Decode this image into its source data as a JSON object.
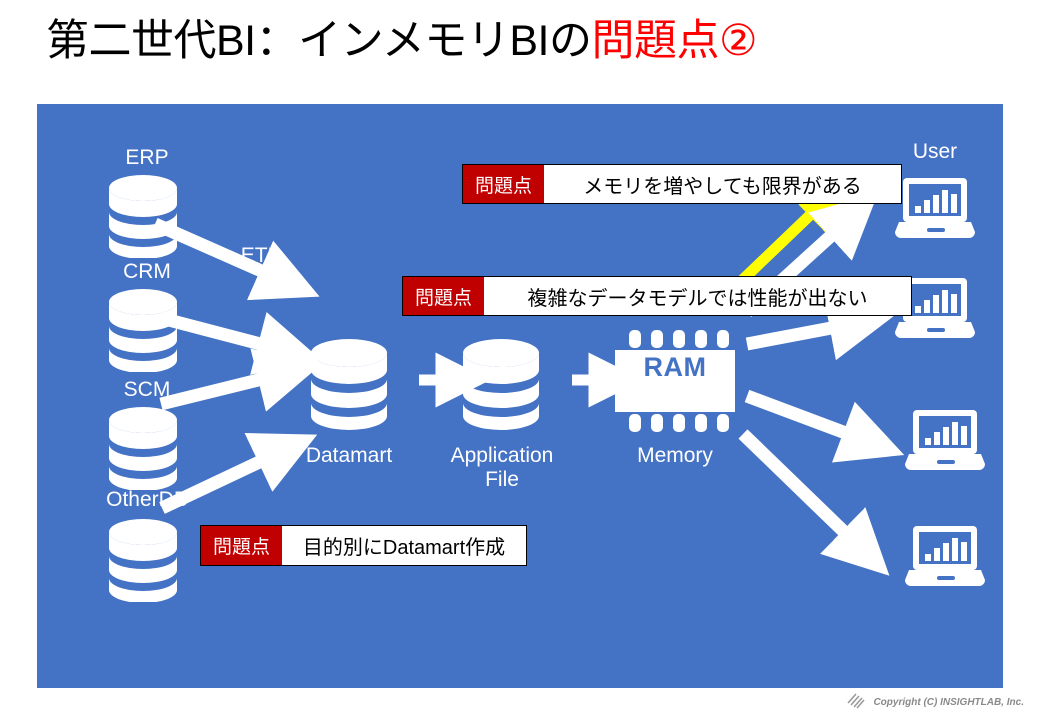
{
  "slide": {
    "title_plain": "第二世代BI：インメモリBIの",
    "title_accent": "問題点②",
    "background": "#FFFFFF",
    "panel_color": "#4472C4",
    "accent_color": "#FF0000",
    "callout_tag_color": "#C00000",
    "highlight_arrow_color": "#FFFF00"
  },
  "sources": [
    {
      "label": "ERP",
      "icon": "database-cylinder-icon"
    },
    {
      "label": "CRM",
      "icon": "database-cylinder-icon"
    },
    {
      "label": "SCM",
      "icon": "database-cylinder-icon"
    },
    {
      "label": "OtherDB",
      "icon": "database-cylinder-icon"
    }
  ],
  "pipeline": {
    "etl_label": "ETL",
    "datamart_label": "Datamart",
    "application_file_label": "Application\nFile",
    "memory_label": "Memory",
    "ram_label": "RAM",
    "datamart_icon": "database-cylinder-icon",
    "application_file_icon": "database-cylinder-icon",
    "memory_icon": "ram-chip-icon"
  },
  "users": {
    "label": "User",
    "icon": "laptop-chart-icon",
    "count": 4
  },
  "callouts": [
    {
      "tag": "問題点",
      "text": "メモリを増やしても限界がある",
      "name": "callout-memory-limit"
    },
    {
      "tag": "問題点",
      "text": "複雑なデータモデルでは性能が出ない",
      "name": "callout-complex-model"
    },
    {
      "tag": "問題点",
      "text": "目的別にDatamart作成",
      "name": "callout-datamart-per-purpose"
    }
  ],
  "footer": {
    "copyright": "Copyright (C) INSIGHTLAB, Inc.",
    "logo_icon": "hatched-logo-icon"
  }
}
